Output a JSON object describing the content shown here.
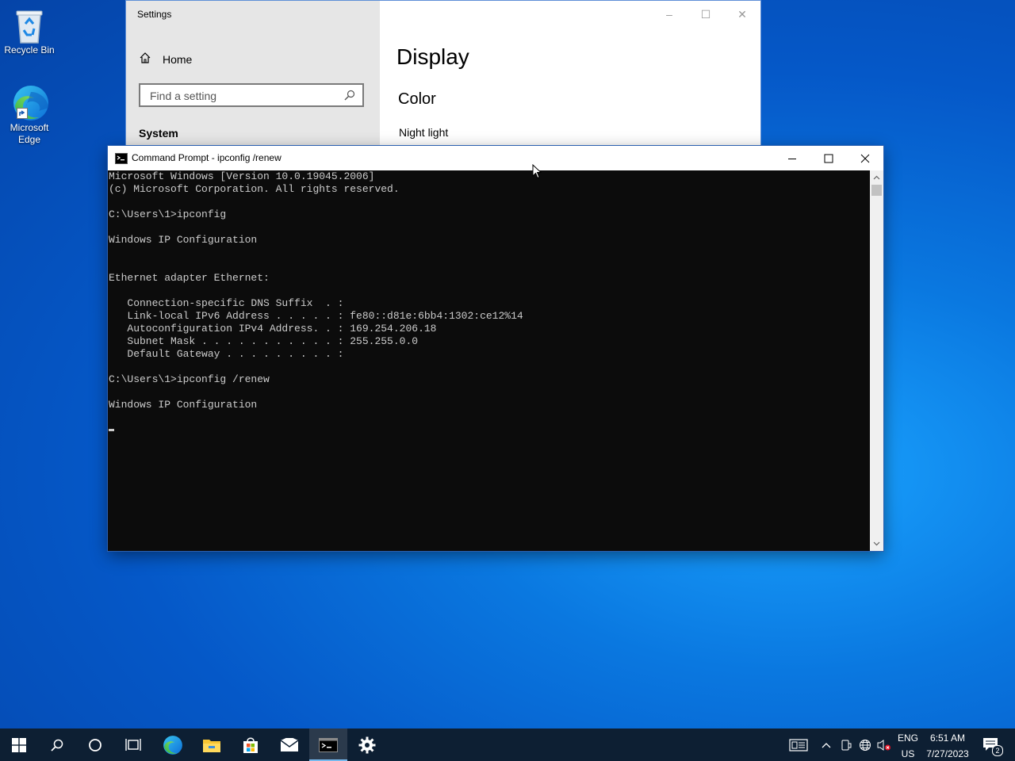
{
  "desktop": {
    "icons": [
      {
        "label": "Recycle Bin"
      },
      {
        "label": "Microsoft Edge"
      }
    ]
  },
  "settings": {
    "window_title": "Settings",
    "home_label": "Home",
    "search_placeholder": "Find a setting",
    "section_label": "System",
    "page_title": "Display",
    "group_heading": "Color",
    "night_light_label": "Night light",
    "controls": {
      "minimize": "–",
      "maximize": "☐",
      "close": "✕"
    }
  },
  "cmd": {
    "window_title": "Command Prompt - ipconfig  /renew",
    "output_lines": [
      "Microsoft Windows [Version 10.0.19045.2006]",
      "(c) Microsoft Corporation. All rights reserved.",
      "",
      "C:\\Users\\1>ipconfig",
      "",
      "Windows IP Configuration",
      "",
      "",
      "Ethernet adapter Ethernet:",
      "",
      "   Connection-specific DNS Suffix  . :",
      "   Link-local IPv6 Address . . . . . : fe80::d81e:6bb4:1302:ce12%14",
      "   Autoconfiguration IPv4 Address. . : 169.254.206.18",
      "   Subnet Mask . . . . . . . . . . . : 255.255.0.0",
      "   Default Gateway . . . . . . . . . :",
      "",
      "C:\\Users\\1>ipconfig /renew",
      "",
      "Windows IP Configuration",
      ""
    ],
    "colors": {
      "background": "#0c0c0c",
      "text": "#cccccc"
    }
  },
  "taskbar": {
    "apps": [
      "start",
      "search",
      "cortana",
      "task-view",
      "edge",
      "file-explorer",
      "store",
      "mail",
      "command-prompt",
      "settings"
    ],
    "active_app": "command-prompt",
    "language_top": "ENG",
    "language_bottom": "US",
    "time": "6:51 AM",
    "date": "7/27/2023",
    "notification_count": "2"
  }
}
